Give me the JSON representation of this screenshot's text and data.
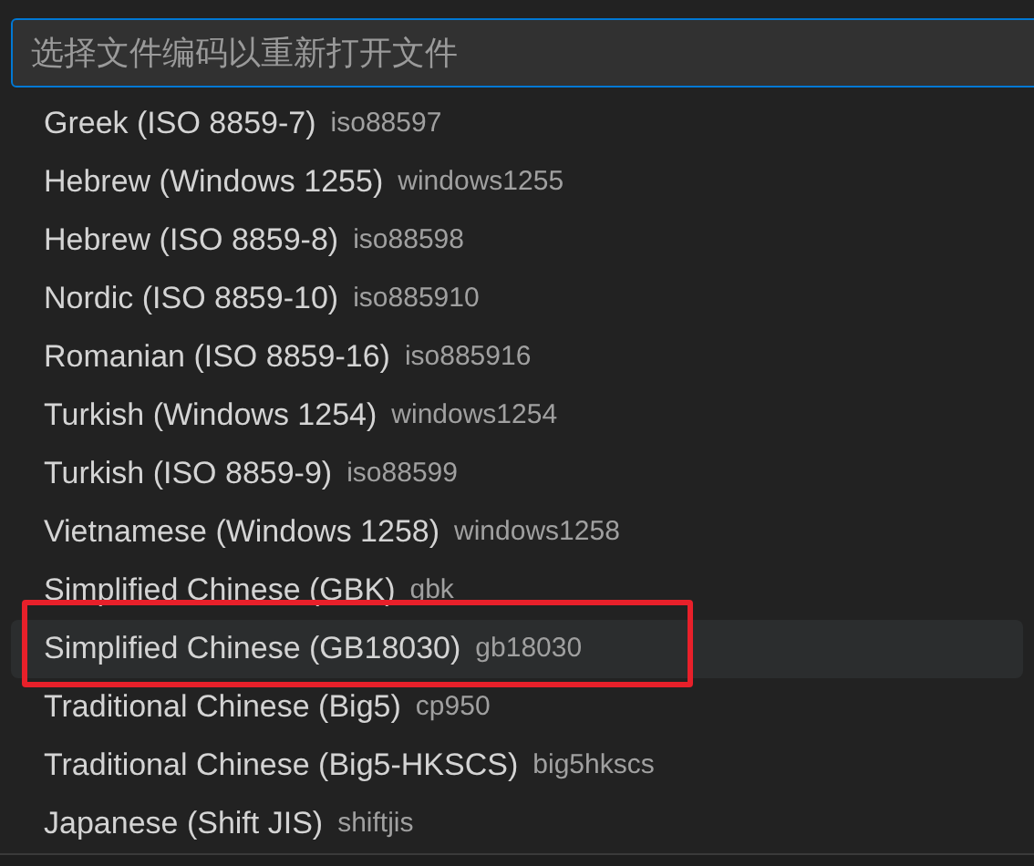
{
  "quick_pick": {
    "placeholder": "选择文件编码以重新打开文件",
    "items": [
      {
        "label": "Greek (ISO 8859-7)",
        "description": "iso88597",
        "selected": false,
        "annotated": false
      },
      {
        "label": "Hebrew (Windows 1255)",
        "description": "windows1255",
        "selected": false,
        "annotated": false
      },
      {
        "label": "Hebrew (ISO 8859-8)",
        "description": "iso88598",
        "selected": false,
        "annotated": false
      },
      {
        "label": "Nordic (ISO 8859-10)",
        "description": "iso885910",
        "selected": false,
        "annotated": false
      },
      {
        "label": "Romanian (ISO 8859-16)",
        "description": "iso885916",
        "selected": false,
        "annotated": false
      },
      {
        "label": "Turkish (Windows 1254)",
        "description": "windows1254",
        "selected": false,
        "annotated": false
      },
      {
        "label": "Turkish (ISO 8859-9)",
        "description": "iso88599",
        "selected": false,
        "annotated": false
      },
      {
        "label": "Vietnamese (Windows 1258)",
        "description": "windows1258",
        "selected": false,
        "annotated": false
      },
      {
        "label": "Simplified Chinese (GBK)",
        "description": "gbk",
        "selected": false,
        "annotated": false
      },
      {
        "label": "Simplified Chinese (GB18030)",
        "description": "gb18030",
        "selected": true,
        "annotated": true
      },
      {
        "label": "Traditional Chinese (Big5)",
        "description": "cp950",
        "selected": false,
        "annotated": false
      },
      {
        "label": "Traditional Chinese (Big5-HKSCS)",
        "description": "big5hkscs",
        "selected": false,
        "annotated": false
      },
      {
        "label": "Japanese (Shift JIS)",
        "description": "shiftjis",
        "selected": false,
        "annotated": false
      }
    ]
  }
}
